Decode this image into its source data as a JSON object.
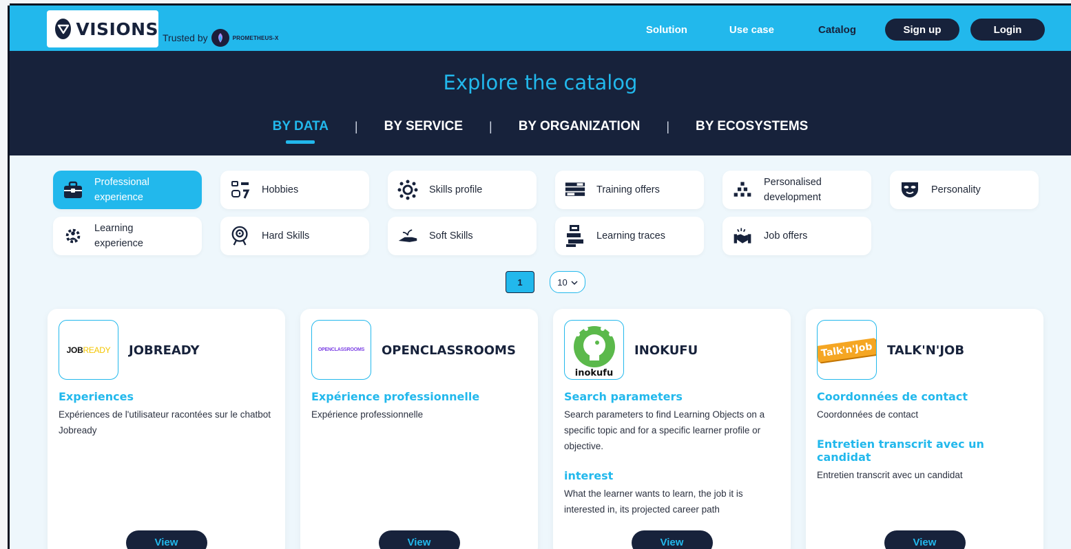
{
  "header": {
    "brand": "VISIONS",
    "trusted_by": "Trusted by",
    "partner": "PROMETHEUS-X",
    "nav": [
      "Solution",
      "Use case",
      "Catalog"
    ],
    "signup": "Sign up",
    "login": "Login",
    "colors": {
      "accent": "#22b8ec",
      "dark": "#17223b"
    }
  },
  "hero": {
    "title": "Explore the catalog",
    "tabs": [
      "BY DATA",
      "BY SERVICE",
      "BY ORGANIZATION",
      "BY ECOSYSTEMS"
    ],
    "active_tab": "BY DATA"
  },
  "categories": [
    {
      "label": "Professional experience",
      "icon": "briefcase-icon",
      "active": true
    },
    {
      "label": "Hobbies",
      "icon": "hobbies-icon"
    },
    {
      "label": "Skills profile",
      "icon": "skills-network-icon"
    },
    {
      "label": "Training offers",
      "icon": "training-board-icon"
    },
    {
      "label": "Personalised development",
      "icon": "growth-pyramid-icon"
    },
    {
      "label": "Personality",
      "icon": "mask-icon"
    },
    {
      "label": "Learning experience",
      "icon": "gear-person-icon"
    },
    {
      "label": "Hard Skills",
      "icon": "target-head-icon"
    },
    {
      "label": "Soft Skills",
      "icon": "hand-plant-icon"
    },
    {
      "label": "Learning traces",
      "icon": "person-desk-icon"
    },
    {
      "label": "Job offers",
      "icon": "handshake-icon"
    }
  ],
  "pagination": {
    "current_page": "1",
    "page_size": "10"
  },
  "cards": [
    {
      "name": "JOBREADY",
      "logo_text": "JOBREADY",
      "sections": [
        {
          "title": "Experiences",
          "desc": "Expériences de l'utilisateur racontées sur le chatbot Jobready"
        }
      ],
      "button": "View"
    },
    {
      "name": "OPENCLASSROOMS",
      "logo_text": "OPENCLASSROOMS",
      "sections": [
        {
          "title": "Expérience professionnelle",
          "desc": "Expérience professionnelle"
        }
      ],
      "button": "View"
    },
    {
      "name": "INOKUFU",
      "logo_text": "inokufu",
      "sections": [
        {
          "title": "Search parameters",
          "desc": "Search parameters to find Learning Objects on a specific topic and for a specific learner profile or objective."
        },
        {
          "title": "interest",
          "desc": "What the learner wants to learn, the job it is interested in, its projected career path"
        }
      ],
      "button": "View"
    },
    {
      "name": "TALK'N'JOB",
      "logo_text": "Talk'n'Job",
      "sections": [
        {
          "title": "Coordonnées de contact",
          "desc": "Coordonnées de contact"
        },
        {
          "title": "Entretien transcrit avec un candidat",
          "desc": "Entretien transcrit avec un candidat"
        }
      ],
      "button": "View"
    }
  ]
}
